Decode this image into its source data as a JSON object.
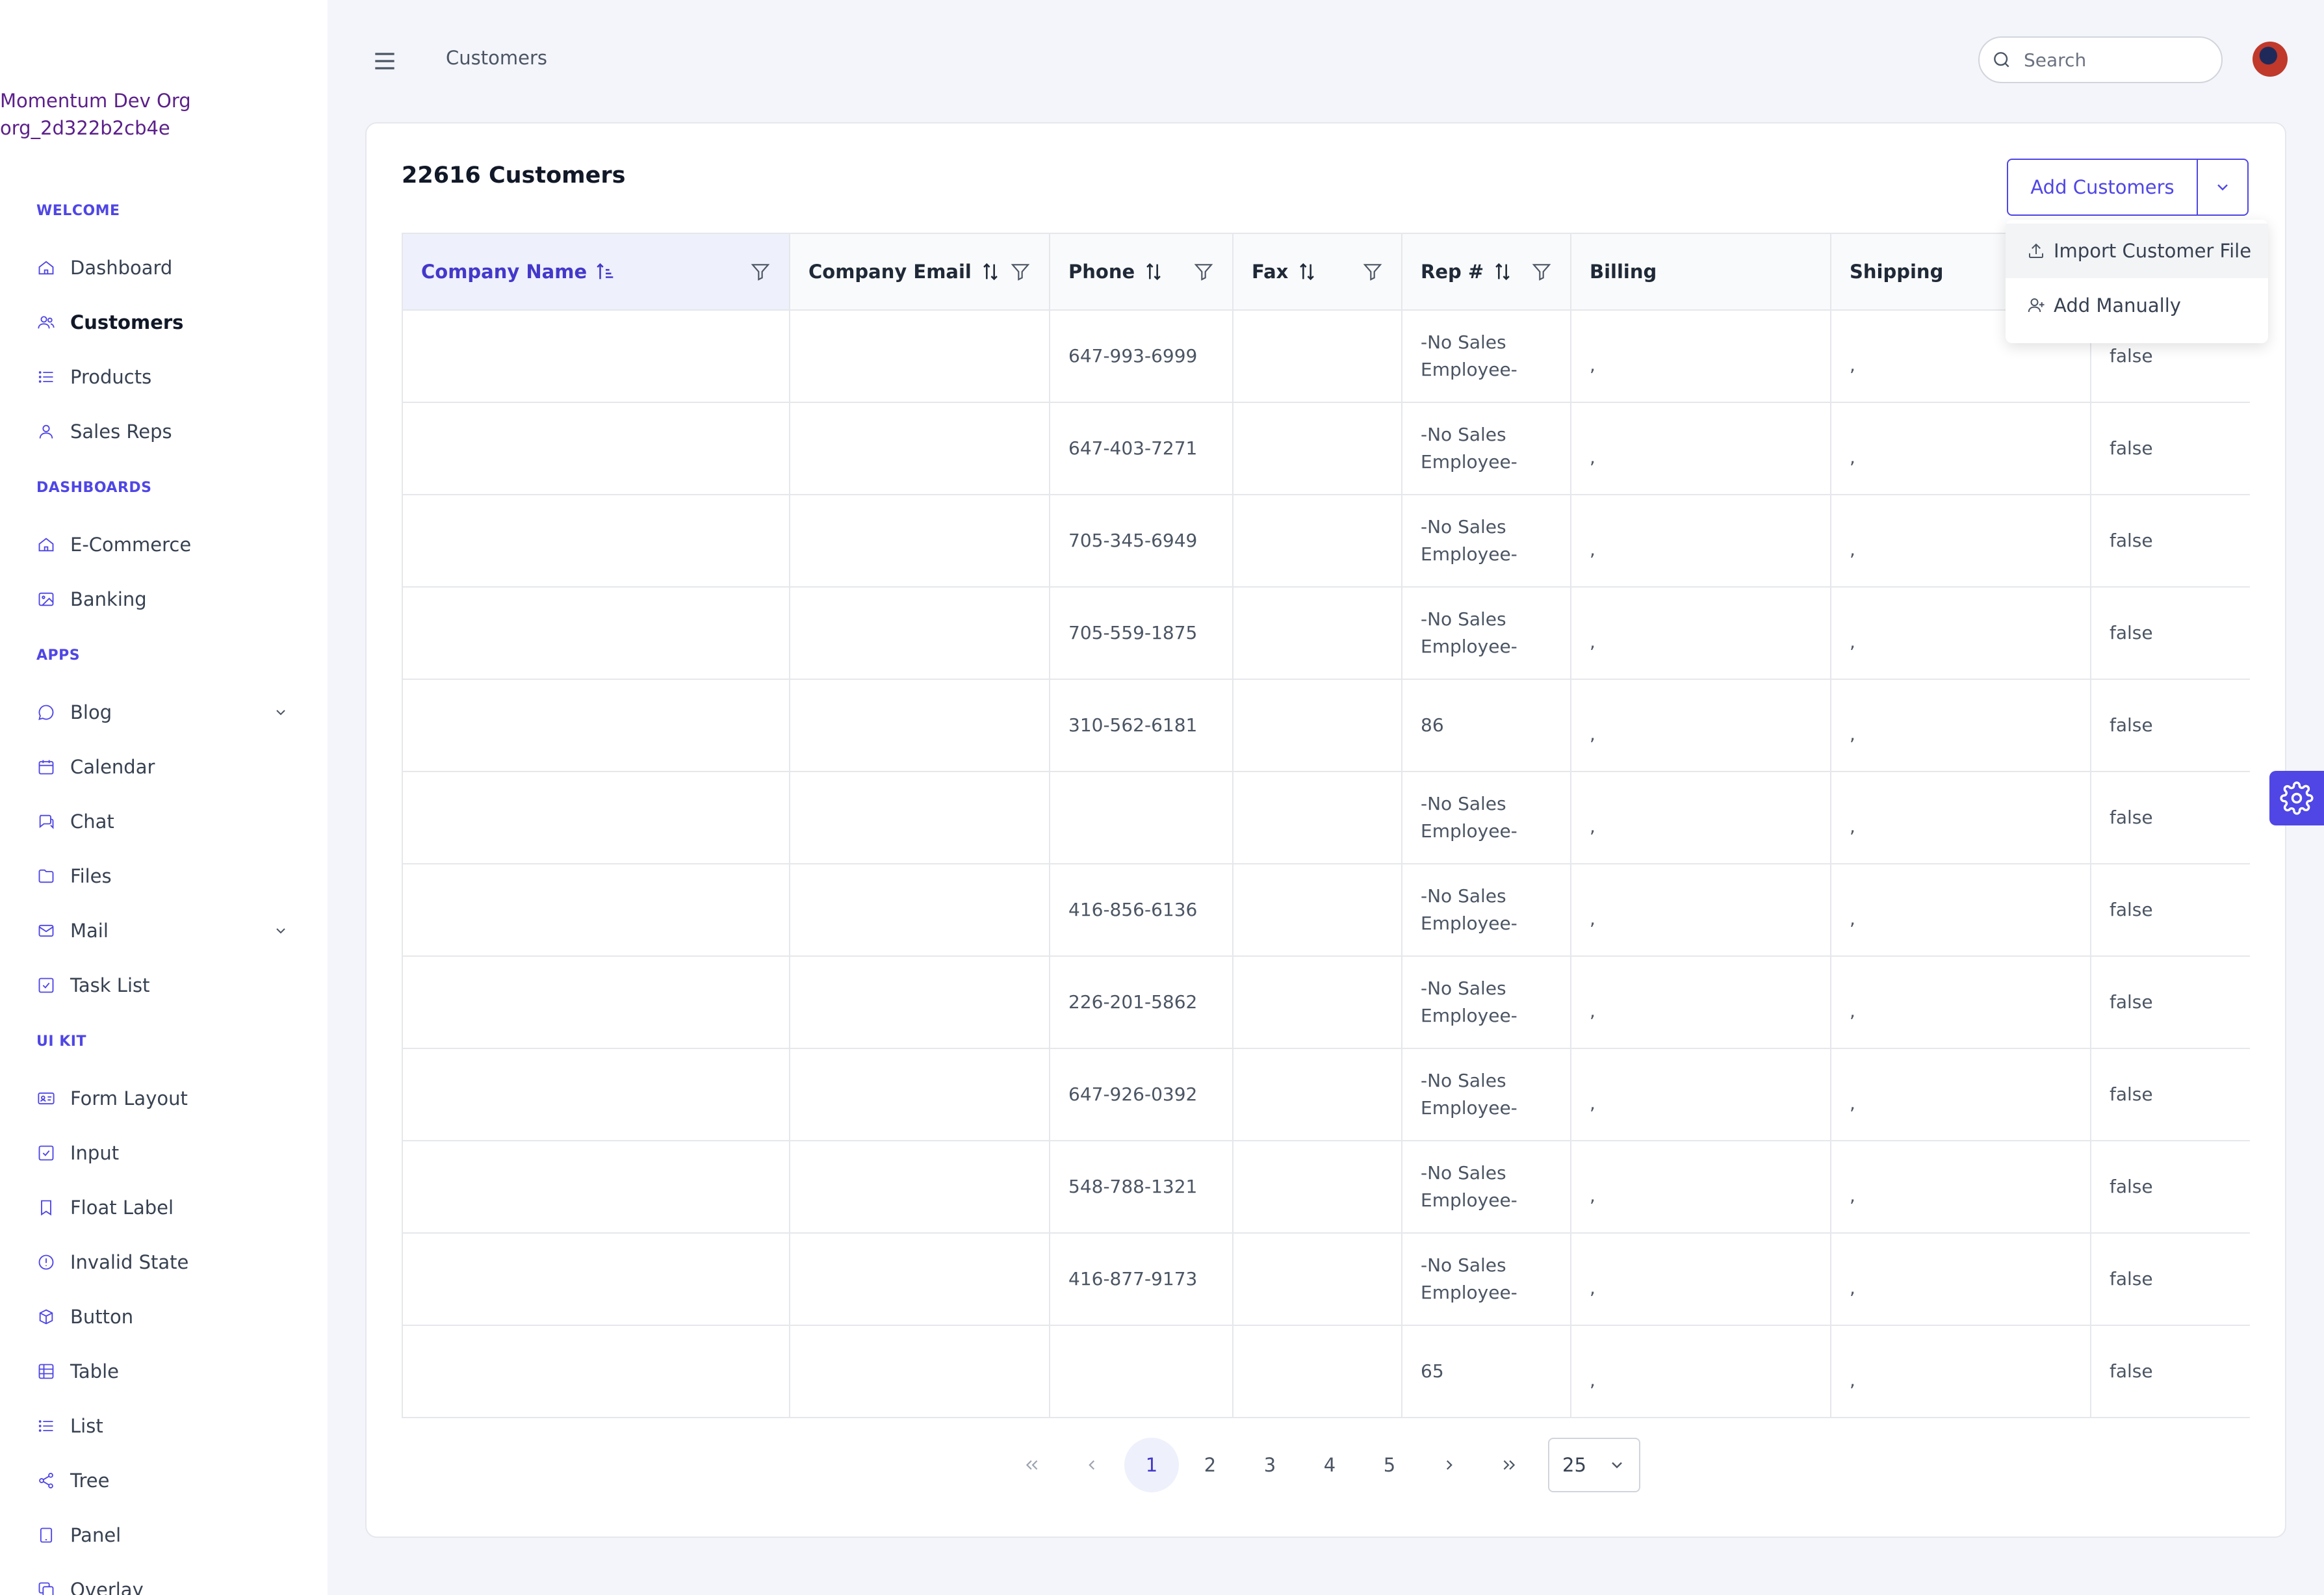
{
  "org": {
    "name": "Momentum Dev Org",
    "id": "org_2d322b2cb4e"
  },
  "sidebar": {
    "sections": [
      {
        "title": "WELCOME",
        "items": [
          {
            "label": "Dashboard",
            "icon": "home-icon"
          },
          {
            "label": "Customers",
            "icon": "users-icon",
            "active": true
          },
          {
            "label": "Products",
            "icon": "list-icon"
          },
          {
            "label": "Sales Reps",
            "icon": "user-icon"
          }
        ]
      },
      {
        "title": "DASHBOARDS",
        "items": [
          {
            "label": "E-Commerce",
            "icon": "home-icon"
          },
          {
            "label": "Banking",
            "icon": "image-icon"
          }
        ]
      },
      {
        "title": "APPS",
        "items": [
          {
            "label": "Blog",
            "icon": "comment-icon",
            "expandable": true
          },
          {
            "label": "Calendar",
            "icon": "calendar-icon"
          },
          {
            "label": "Chat",
            "icon": "chat-icon"
          },
          {
            "label": "Files",
            "icon": "folder-icon"
          },
          {
            "label": "Mail",
            "icon": "mail-icon",
            "expandable": true
          },
          {
            "label": "Task List",
            "icon": "check-square-icon"
          }
        ]
      },
      {
        "title": "UI KIT",
        "items": [
          {
            "label": "Form Layout",
            "icon": "id-card-icon"
          },
          {
            "label": "Input",
            "icon": "check-square-icon"
          },
          {
            "label": "Float Label",
            "icon": "bookmark-icon"
          },
          {
            "label": "Invalid State",
            "icon": "exclamation-circle-icon"
          },
          {
            "label": "Button",
            "icon": "box-icon"
          },
          {
            "label": "Table",
            "icon": "table-icon"
          },
          {
            "label": "List",
            "icon": "list-icon"
          },
          {
            "label": "Tree",
            "icon": "share-icon"
          },
          {
            "label": "Panel",
            "icon": "tablet-icon"
          },
          {
            "label": "Overlay",
            "icon": "clone-icon"
          }
        ]
      }
    ]
  },
  "topbar": {
    "title": "Customers",
    "search_placeholder": "Search"
  },
  "page": {
    "title": "22616 Customers",
    "add_button": "Add Customers",
    "dropdown": [
      "Import Customer File",
      "Add Manually"
    ]
  },
  "table": {
    "columns": [
      "Company Name",
      "Company Email",
      "Phone",
      "Fax",
      "Rep #",
      "Billing",
      "Shipping",
      ""
    ],
    "rows": [
      {
        "company": "",
        "email": "",
        "phone": "647-993-6999",
        "fax": "",
        "rep": "-No Sales Employee-",
        "billing": ",",
        "shipping": ",",
        "flag": "false"
      },
      {
        "company": "",
        "email": "",
        "phone": "647-403-7271",
        "fax": "",
        "rep": "-No Sales Employee-",
        "billing": ",",
        "shipping": ",",
        "flag": "false"
      },
      {
        "company": "",
        "email": "",
        "phone": "705-345-6949",
        "fax": "",
        "rep": "-No Sales Employee-",
        "billing": ",",
        "shipping": ",",
        "flag": "false"
      },
      {
        "company": "",
        "email": "",
        "phone": "705-559-1875",
        "fax": "",
        "rep": "-No Sales Employee-",
        "billing": ",",
        "shipping": ",",
        "flag": "false"
      },
      {
        "company": "",
        "email": "",
        "phone": "310-562-6181",
        "fax": "",
        "rep": "86",
        "billing": ",",
        "shipping": ",",
        "flag": "false"
      },
      {
        "company": "",
        "email": "",
        "phone": "",
        "fax": "",
        "rep": "-No Sales Employee-",
        "billing": ",",
        "shipping": ",",
        "flag": "false"
      },
      {
        "company": "",
        "email": "",
        "phone": "416-856-6136",
        "fax": "",
        "rep": "-No Sales Employee-",
        "billing": ",",
        "shipping": ",",
        "flag": "false"
      },
      {
        "company": "",
        "email": "",
        "phone": "226-201-5862",
        "fax": "",
        "rep": "-No Sales Employee-",
        "billing": ",",
        "shipping": ",",
        "flag": "false"
      },
      {
        "company": "",
        "email": "",
        "phone": "647-926-0392",
        "fax": "",
        "rep": "-No Sales Employee-",
        "billing": ",",
        "shipping": ",",
        "flag": "false"
      },
      {
        "company": "",
        "email": "",
        "phone": "548-788-1321",
        "fax": "",
        "rep": "-No Sales Employee-",
        "billing": ",",
        "shipping": ",",
        "flag": "false"
      },
      {
        "company": "",
        "email": "",
        "phone": "416-877-9173",
        "fax": "",
        "rep": "-No Sales Employee-",
        "billing": ",",
        "shipping": ",",
        "flag": "false"
      },
      {
        "company": "",
        "email": "",
        "phone": "",
        "fax": "",
        "rep": "65",
        "billing": ",",
        "shipping": ",",
        "flag": "false"
      }
    ]
  },
  "pagination": {
    "pages": [
      "1",
      "2",
      "3",
      "4",
      "5"
    ],
    "current": "1",
    "rows_per_page": "25"
  },
  "colors": {
    "accent": "#4f46e5",
    "org_text": "#5b1f8a"
  }
}
